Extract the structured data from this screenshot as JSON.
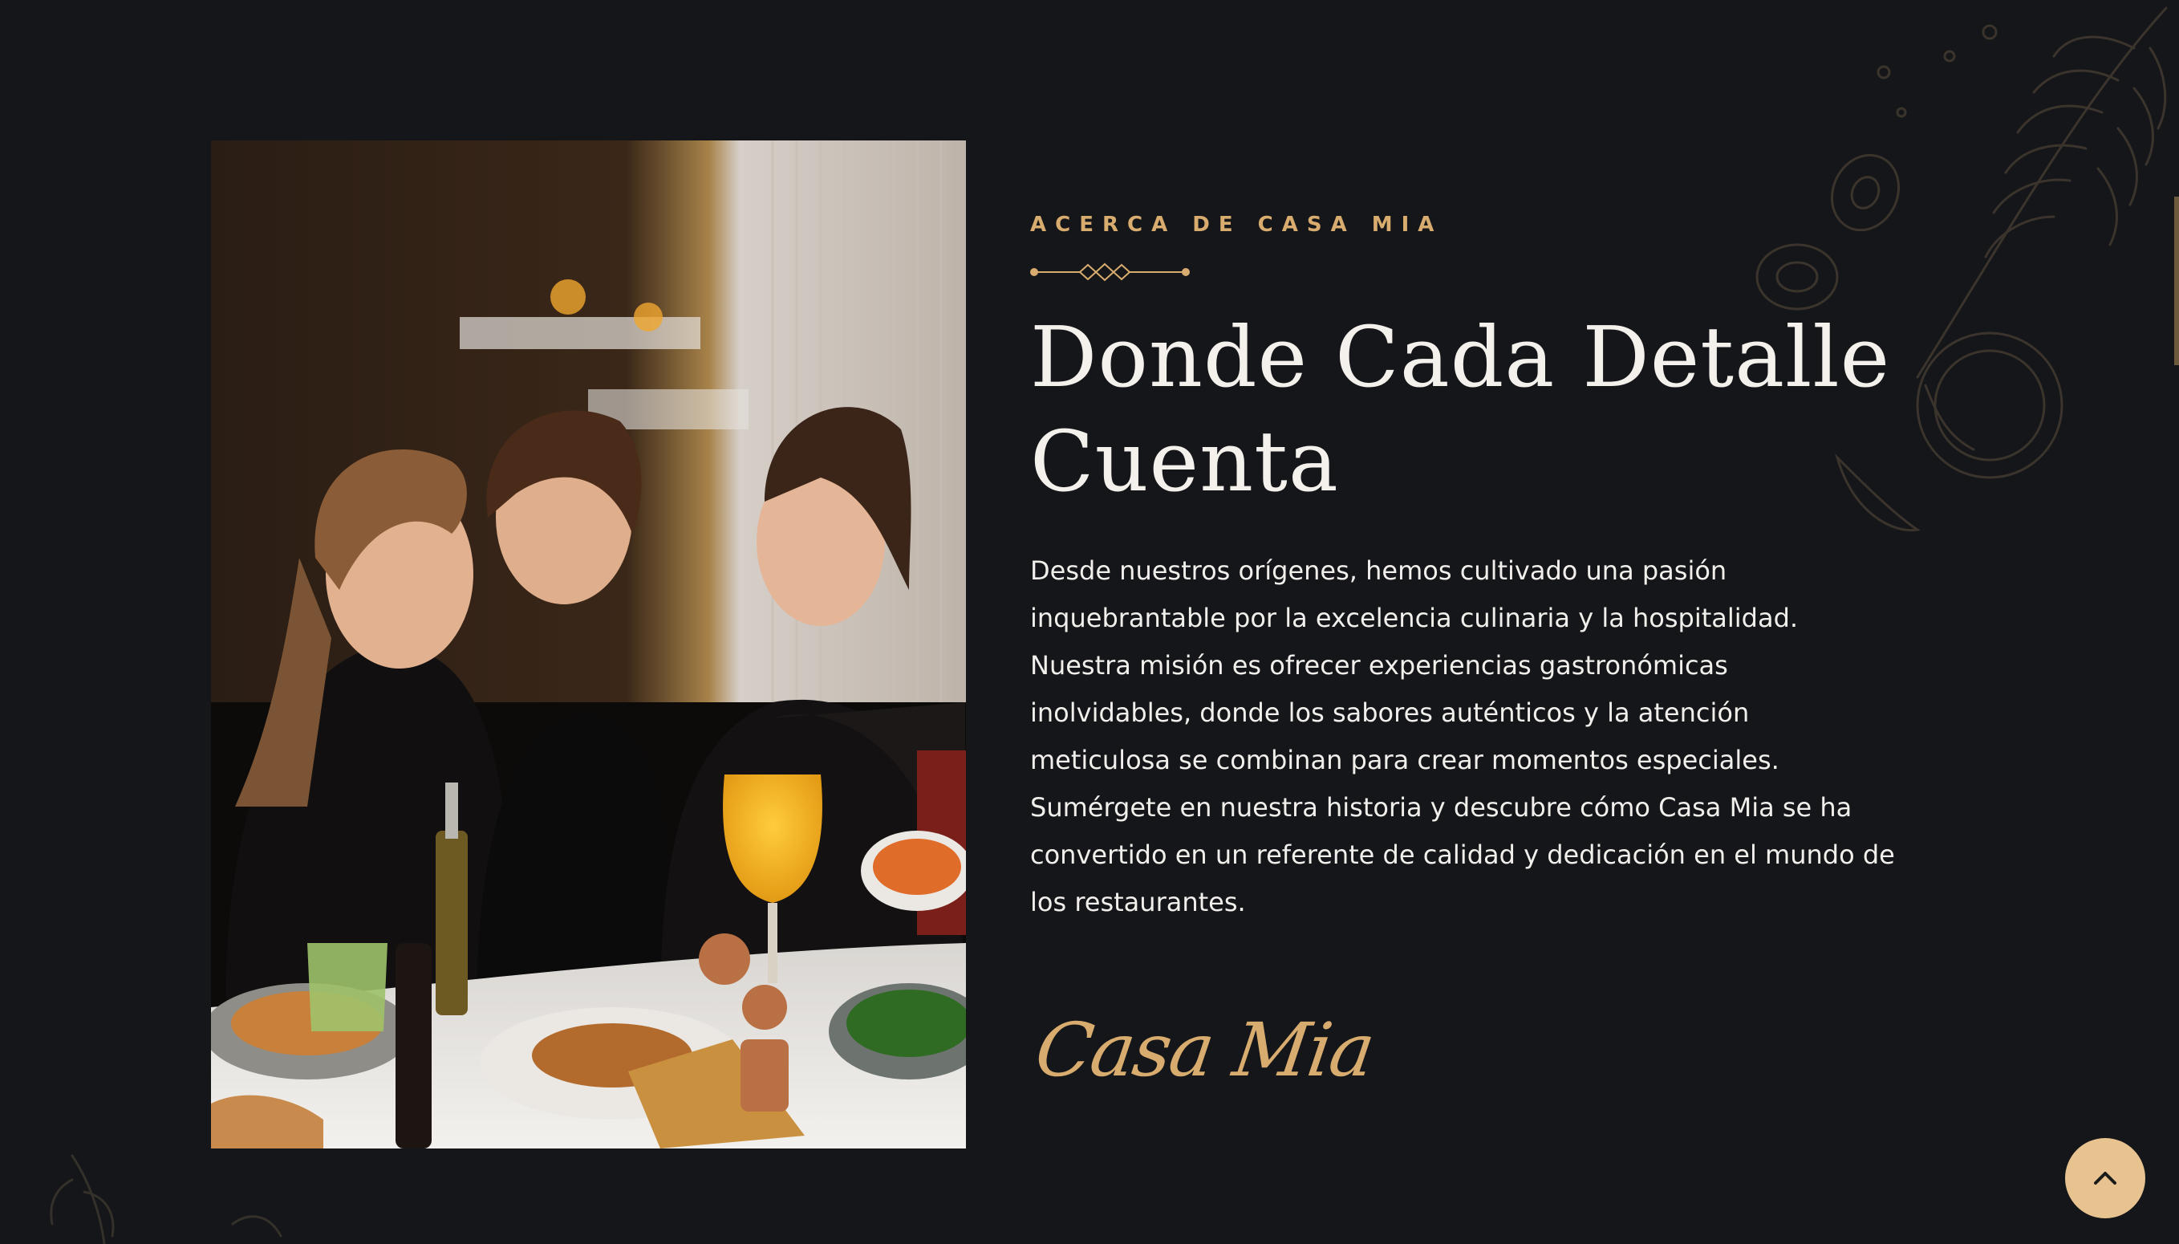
{
  "about": {
    "eyebrow": "ACERCA DE CASA MIA",
    "title_line1": "Donde Cada Detalle",
    "title_line2": "Cuenta",
    "body": "Desde nuestros orígenes, hemos cultivado una pasión inquebrantable por la excelencia culinaria y la hospitalidad. Nuestra misión es ofrecer experiencias gastronómicas inolvidables, donde los sabores auténticos y la atención meticulosa se combinan para crear momentos especiales. Sumérgete en nuestra historia y descubre cómo Casa Mia se ha convertido en un referente de calidad y dedicación en el mundo de los restaurantes.",
    "signature": "Casa Mia"
  },
  "photo": {
    "icon": "restaurant-diners-photo"
  },
  "scroll_top": {
    "icon": "chevron-up-icon"
  },
  "colors": {
    "background": "#151619",
    "accent": "#d8ab6e",
    "button": "#e8c38f",
    "text": "#f1efec"
  }
}
